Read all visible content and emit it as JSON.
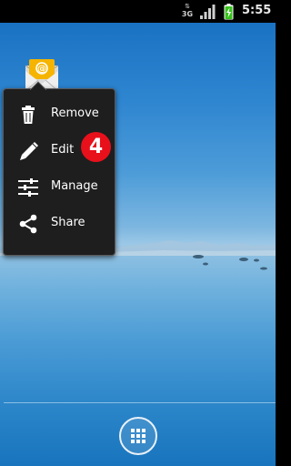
{
  "status_bar": {
    "network_type": "3G",
    "time": "5:55",
    "icons": [
      "data-activity-arrows-icon",
      "signal-strength-icon",
      "battery-charging-icon"
    ]
  },
  "home_shortcut": {
    "icon": "email-icon"
  },
  "context_menu": {
    "items": [
      {
        "label": "Remove",
        "icon": "trash-icon"
      },
      {
        "label": "Edit",
        "icon": "pencil-icon"
      },
      {
        "label": "Manage",
        "icon": "sliders-icon"
      },
      {
        "label": "Share",
        "icon": "share-icon"
      }
    ]
  },
  "step_badge": {
    "number": "4",
    "color": "#e8101b"
  },
  "dock": {
    "app_drawer_icon": "grid-icon"
  },
  "colors": {
    "menu_background": "#1e1e1e",
    "status_bar": "#000000",
    "wallpaper_sky": "#1a72c3"
  }
}
